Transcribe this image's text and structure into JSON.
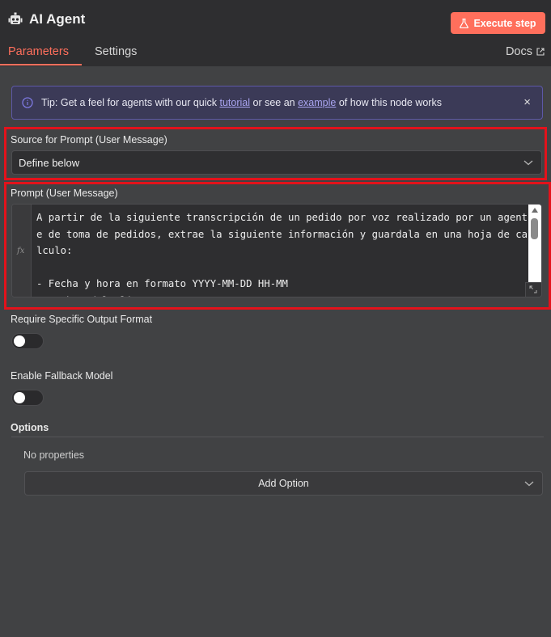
{
  "header": {
    "title": "AI Agent",
    "execute_label": "Execute step",
    "tabs": [
      {
        "label": "Parameters"
      },
      {
        "label": "Settings"
      }
    ],
    "docs_label": "Docs"
  },
  "tip": {
    "prefix": "Tip: Get a feel for agents with our quick ",
    "link1": "tutorial",
    "middle": " or see an ",
    "link2": "example",
    "suffix": " of how this node works",
    "close": "×"
  },
  "source": {
    "label": "Source for Prompt (User Message)",
    "value": "Define below"
  },
  "prompt": {
    "label": "Prompt (User Message)",
    "fx": "fx",
    "text": "A partir de la siguiente transcripción de un pedido por voz realizado por un agente de toma de pedidos, extrae la siguiente información y guardala en una hoja de calculo:\n\n- Fecha y hora en formato YYYY-MM-DD HH-MM\n- Nombre del cliente"
  },
  "output_format": {
    "label": "Require Specific Output Format"
  },
  "fallback": {
    "label": "Enable Fallback Model"
  },
  "options": {
    "label": "Options",
    "empty": "No properties",
    "add_label": "Add Option"
  },
  "colors": {
    "accent": "#ff6f5c",
    "tip_bg": "#3b3a57",
    "highlight": "#e3121b"
  }
}
